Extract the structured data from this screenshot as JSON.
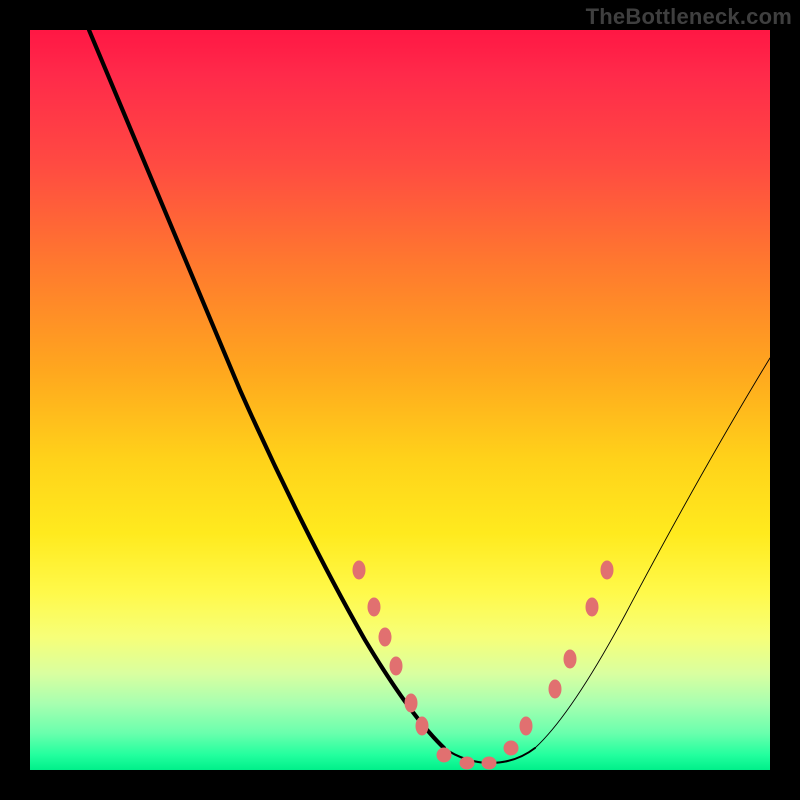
{
  "watermark": "TheBottleneck.com",
  "chart_data": {
    "type": "line",
    "title": "",
    "xlabel": "",
    "ylabel": "",
    "xlim": [
      0,
      100
    ],
    "ylim": [
      0,
      100
    ],
    "series": [
      {
        "name": "curve",
        "x": [
          8,
          14,
          20,
          26,
          32,
          38,
          44,
          48,
          52,
          55,
          57,
          59,
          62,
          66,
          70,
          74,
          78,
          84,
          90,
          96,
          100
        ],
        "y": [
          100,
          88,
          76,
          64,
          52,
          40,
          28,
          18,
          10,
          5,
          2,
          1,
          1,
          4,
          8,
          14,
          22,
          32,
          42,
          50,
          56
        ]
      }
    ],
    "markers": [
      {
        "x": 44.5,
        "y": 27
      },
      {
        "x": 46.5,
        "y": 22
      },
      {
        "x": 48.0,
        "y": 18
      },
      {
        "x": 49.5,
        "y": 14
      },
      {
        "x": 51.5,
        "y": 9
      },
      {
        "x": 53.0,
        "y": 6
      },
      {
        "x": 56.0,
        "y": 2
      },
      {
        "x": 59.0,
        "y": 1
      },
      {
        "x": 62.0,
        "y": 1
      },
      {
        "x": 65.0,
        "y": 3
      },
      {
        "x": 67.0,
        "y": 6
      },
      {
        "x": 71.0,
        "y": 11
      },
      {
        "x": 73.0,
        "y": 15
      },
      {
        "x": 76.0,
        "y": 22
      },
      {
        "x": 78.0,
        "y": 27
      }
    ],
    "curve_stroke_widths": {
      "left_top": 4.2,
      "mid": 2.0,
      "right_top": 0.9
    },
    "marker_color": "#e17070"
  }
}
